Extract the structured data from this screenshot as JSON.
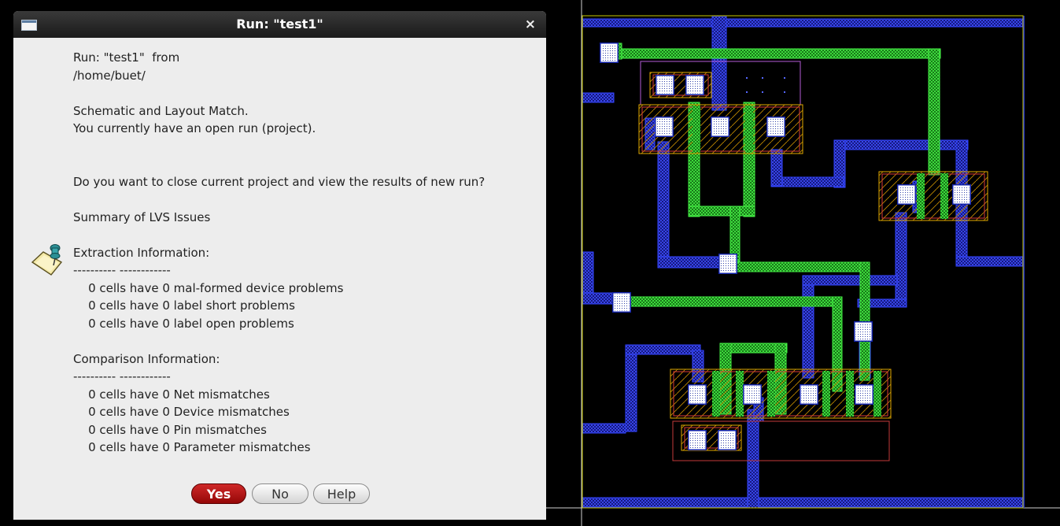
{
  "dialog": {
    "title": "Run: \"test1\"",
    "close_glyph": "×",
    "icon": "window-icon",
    "note_icon": "notepad-pin-icon",
    "lines": [
      "Run: \"test1\"  from",
      "/home/buet/",
      "",
      "Schematic and Layout Match.",
      "You currently have an open run (project).",
      "",
      "",
      "Do you want to close current project and view the results of new run?",
      "",
      "Summary of LVS Issues",
      "",
      "Extraction Information:",
      "---------- ------------",
      "    0 cells have 0 mal-formed device problems",
      "    0 cells have 0 label short problems",
      "    0 cells have 0 label open problems",
      "",
      "Comparison Information:",
      "---------- ------------",
      "    0 cells have 0 Net mismatches",
      "    0 cells have 0 Device mismatches",
      "    0 cells have 0 Pin mismatches",
      "    0 cells have 0 Parameter mismatches"
    ],
    "buttons": {
      "yes": "Yes",
      "no": "No",
      "help": "Help"
    }
  },
  "layout_view": {
    "background": "#000000",
    "colors": {
      "metal1": "#3344ff",
      "poly": "#33dd33",
      "nwell": "#ff5555",
      "diffusion": "#ffcc00",
      "boundary": "#b35bd6"
    }
  }
}
